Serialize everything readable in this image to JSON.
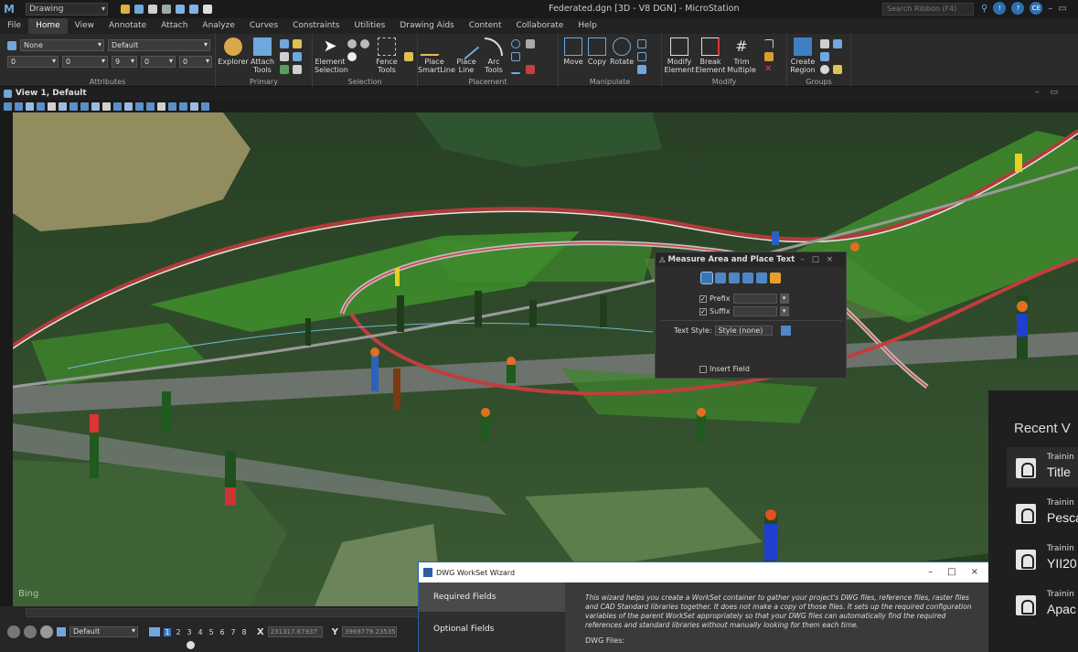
{
  "titlebar": {
    "workspace": "Drawing",
    "document_title": "Federated.dgn [3D - V8 DGN] - MicroStation",
    "search_placeholder": "Search Ribbon (F4)",
    "user_badge": "CE"
  },
  "menu": {
    "tabs": [
      "File",
      "Home",
      "View",
      "Annotate",
      "Attach",
      "Analyze",
      "Curves",
      "Constraints",
      "Utilities",
      "Drawing Aids",
      "Content",
      "Collaborate",
      "Help"
    ],
    "active": "Home"
  },
  "ribbon": {
    "attributes": {
      "level_value": "None",
      "style_value": "Default",
      "color_value": "0",
      "weight_value": "0",
      "linestyle_value": "9",
      "transparency_value": "0",
      "priority_value": "0",
      "label": "Attributes"
    },
    "primary": {
      "label": "Primary",
      "explorer": "Explorer",
      "attach_tools": "Attach Tools"
    },
    "selection": {
      "label": "Selection",
      "element_selection": "Element Selection",
      "fence_tools": "Fence Tools"
    },
    "placement": {
      "label": "Placement",
      "place_smartline": "Place SmartLine",
      "place_line": "Place Line",
      "arc_tools": "Arc Tools"
    },
    "manipulate": {
      "label": "Manipulate",
      "move": "Move",
      "copy": "Copy",
      "rotate": "Rotate"
    },
    "modify": {
      "label": "Modify",
      "modify_element": "Modify Element",
      "break_element": "Break Element",
      "trim_multiple": "Trim Multiple"
    },
    "groups": {
      "label": "Groups",
      "create_region": "Create Region"
    }
  },
  "view": {
    "title": "View 1, Default"
  },
  "viewport": {
    "watermark": "Bing"
  },
  "measure_dialog": {
    "title": "Measure Area and Place Text",
    "prefix_label": "Prefix",
    "suffix_label": "Suffix",
    "text_style_label": "Text Style:",
    "text_style_value": "Style (none)",
    "insert_field_label": "Insert Field",
    "prefix_checked": true,
    "suffix_checked": true
  },
  "statusbar": {
    "level_value": "Default",
    "view_numbers": [
      "1",
      "2",
      "3",
      "4",
      "5",
      "6",
      "7",
      "8"
    ],
    "active_view": "1",
    "x_label": "X",
    "x_value": "231317.67937",
    "y_label": "Y",
    "y_value": "3969779.23535"
  },
  "wizard": {
    "title": "DWG WorkSet Wizard",
    "nav": [
      "Required Fields",
      "Optional Fields"
    ],
    "active_nav": "Required Fields",
    "description": "This wizard helps you create a WorkSet container to gather your project's DWG files, reference files, raster files and CAD Standard libraries together. It does not make a copy of those files. It sets up the required configuration variables of the parent WorkSet appropriately so that your DWG files can automatically find the required references and standard libraries without manually looking for them each time.",
    "dwg_files_label": "DWG Files:"
  },
  "recent": {
    "heading": "Recent V",
    "items": [
      {
        "line1": "Trainin",
        "line2": "Title"
      },
      {
        "line1": "Trainin",
        "line2": "Pesca"
      },
      {
        "line1": "Trainin",
        "line2": "YII20"
      },
      {
        "line1": "Trainin",
        "line2": "Apac"
      }
    ]
  }
}
